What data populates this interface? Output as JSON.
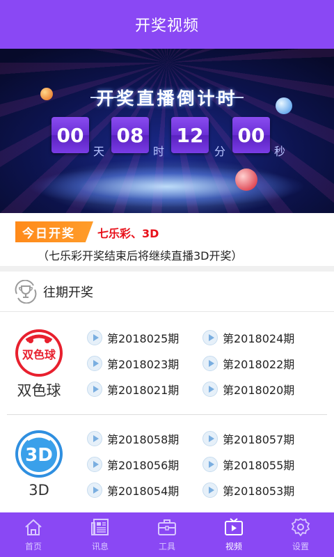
{
  "header": {
    "title": "开奖视频"
  },
  "banner": {
    "title": "开奖直播倒计时",
    "countdown": [
      {
        "value": "00",
        "unit": "天"
      },
      {
        "value": "08",
        "unit": "时"
      },
      {
        "value": "12",
        "unit": "分"
      },
      {
        "value": "00",
        "unit": "秒"
      }
    ]
  },
  "today": {
    "tag": "今日开奖",
    "games": "七乐彩、3D",
    "note": "（七乐彩开奖结束后将继续直播3D开奖）"
  },
  "past": {
    "title": "往期开奖",
    "lotteries": [
      {
        "name": "双色球",
        "logo_text": "双色球",
        "periods": [
          "第2018025期",
          "第2018024期",
          "第2018023期",
          "第2018022期",
          "第2018021期",
          "第2018020期"
        ]
      },
      {
        "name": "3D",
        "logo_text": "3D",
        "periods": [
          "第2018058期",
          "第2018057期",
          "第2018056期",
          "第2018055期",
          "第2018054期",
          "第2018053期"
        ]
      }
    ]
  },
  "tabbar": {
    "items": [
      {
        "label": "首页",
        "icon": "home-icon"
      },
      {
        "label": "讯息",
        "icon": "news-icon"
      },
      {
        "label": "工具",
        "icon": "toolbox-icon"
      },
      {
        "label": "视频",
        "icon": "video-icon",
        "active": true
      },
      {
        "label": "设置",
        "icon": "gear-icon"
      }
    ]
  },
  "colors": {
    "primary": "#8a48f4",
    "accent_orange": "#ff8a1a",
    "red": "#e8101a"
  }
}
